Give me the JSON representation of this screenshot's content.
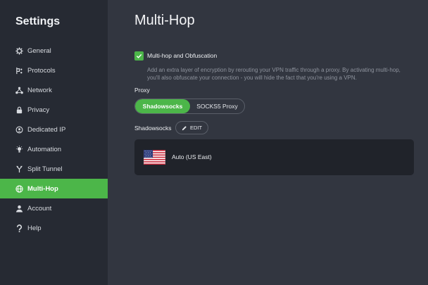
{
  "sidebar": {
    "title": "Settings",
    "items": [
      {
        "label": "General",
        "icon": "gear-icon"
      },
      {
        "label": "Protocols",
        "icon": "protocols-icon"
      },
      {
        "label": "Network",
        "icon": "network-icon"
      },
      {
        "label": "Privacy",
        "icon": "lock-icon"
      },
      {
        "label": "Dedicated IP",
        "icon": "dedicated-ip-icon"
      },
      {
        "label": "Automation",
        "icon": "lightbulb-icon"
      },
      {
        "label": "Split Tunnel",
        "icon": "split-tunnel-icon"
      },
      {
        "label": "Multi-Hop",
        "icon": "globe-icon",
        "active": true
      },
      {
        "label": "Account",
        "icon": "user-icon"
      },
      {
        "label": "Help",
        "icon": "question-icon"
      }
    ]
  },
  "main": {
    "title": "Multi-Hop",
    "multihop": {
      "checked": true,
      "label": "Multi-hop and Obfuscation",
      "description": "Add an extra layer of encryption by rerouting your VPN traffic through a proxy. By activating multi-hop, you'll also obfuscate your connection - you will hide the fact that you're using a VPN."
    },
    "proxy": {
      "label": "Proxy",
      "options": [
        "Shadowsocks",
        "SOCKS5 Proxy"
      ],
      "selected": "Shadowsocks"
    },
    "shadowsocks": {
      "label": "Shadowsocks",
      "edit_label": "EDIT"
    },
    "server": {
      "name": "Auto (US East)",
      "flag": "us-flag"
    }
  },
  "colors": {
    "accent": "#4cb649",
    "sidebar_bg": "#262a33",
    "main_bg": "#323640",
    "card_bg": "#20232a"
  }
}
